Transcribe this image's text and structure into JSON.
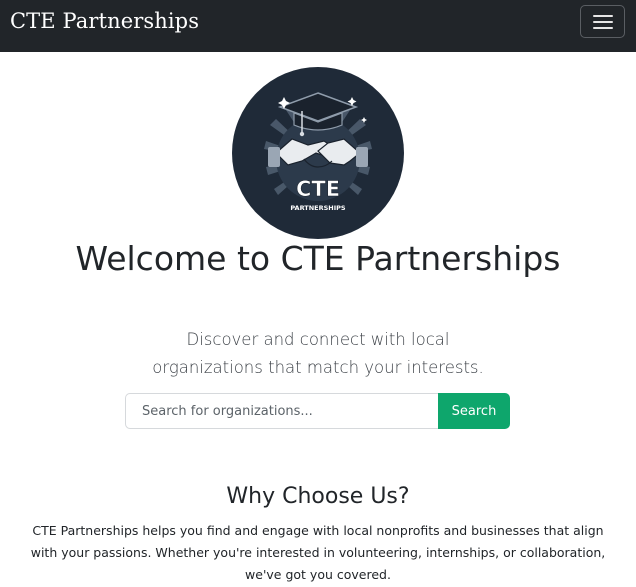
{
  "navbar": {
    "brand": "CTE Partnerships",
    "toggle_icon": "hamburger-menu-icon"
  },
  "hero": {
    "logo": {
      "icon": "handshake-graduation-cap-icon",
      "text_main": "CTE",
      "text_sub": "PARTNERSHIPS"
    },
    "title": "Welcome to CTE Partnerships",
    "subtitle": "Discover and connect with local organizations that match your interests."
  },
  "search": {
    "placeholder": "Search for organizations...",
    "button_label": "Search"
  },
  "why": {
    "title": "Why Choose Us?",
    "text": "CTE Partnerships helps you find and engage with local nonprofits and businesses that align with your passions. Whether you're interested in volunteering, internships, or collaboration, we've got you covered."
  },
  "colors": {
    "navbar_bg": "#212529",
    "accent": "#0ea66c",
    "logo_bg": "#1f2a38"
  }
}
